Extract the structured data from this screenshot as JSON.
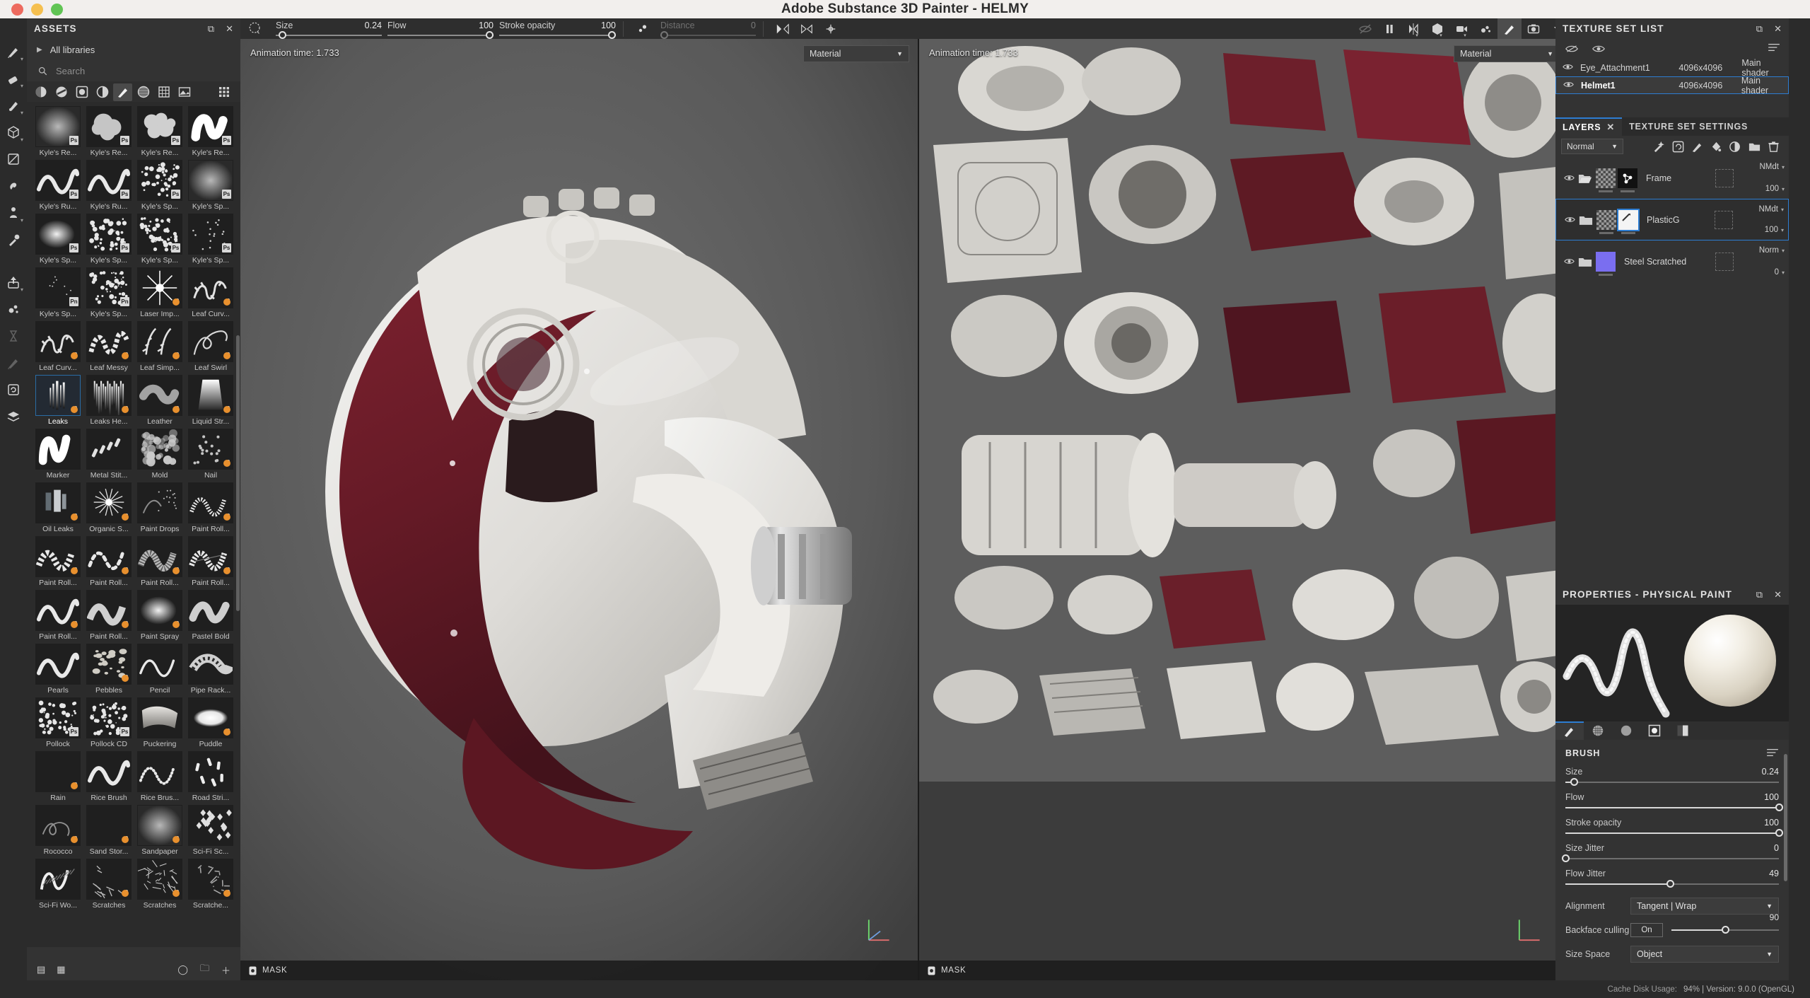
{
  "window": {
    "title": "Adobe Substance 3D Painter - HELMY"
  },
  "toolrail": [
    {
      "name": "paint-brush-tool",
      "icon": "brush",
      "caret": true
    },
    {
      "name": "eraser-tool",
      "icon": "eraser",
      "caret": true
    },
    {
      "name": "projection-tool",
      "icon": "projection",
      "caret": true
    },
    {
      "name": "geometry-decal-tool",
      "icon": "cube",
      "caret": true
    },
    {
      "name": "decal-tool",
      "icon": "decal",
      "caret": false
    },
    {
      "name": "smudge-tool",
      "icon": "smudge",
      "caret": false
    },
    {
      "name": "clone-tool",
      "icon": "clone",
      "caret": true
    },
    {
      "name": "material-picker-tool",
      "icon": "picker",
      "caret": false
    },
    {
      "name": "export-tool",
      "icon": "export",
      "caret": true
    },
    {
      "name": "particles-tool",
      "icon": "particles",
      "caret": false
    },
    {
      "name": "baking-tool",
      "icon": "hourglass",
      "caret": false,
      "dim": true
    },
    {
      "name": "paint-disabled-tool",
      "icon": "brush",
      "caret": false,
      "dim": true
    },
    {
      "name": "generator-tool",
      "icon": "refresh",
      "caret": false
    },
    {
      "name": "layer-stack-tool",
      "icon": "stack",
      "caret": false
    }
  ],
  "assets": {
    "title": "ASSETS",
    "library_label": "All libraries",
    "search_placeholder": "Search",
    "filters": [
      {
        "name": "filter-materials",
        "glyph": "materials"
      },
      {
        "name": "filter-smart-materials",
        "glyph": "smart-materials"
      },
      {
        "name": "filter-masks",
        "glyph": "masks"
      },
      {
        "name": "filter-smart-masks",
        "glyph": "smart-masks"
      },
      {
        "name": "filter-brushes",
        "glyph": "brush",
        "active": true
      },
      {
        "name": "filter-alphas",
        "glyph": "alpha"
      },
      {
        "name": "filter-textures",
        "glyph": "textures"
      },
      {
        "name": "filter-environments",
        "glyph": "environment"
      },
      {
        "name": "filter-grid-view",
        "glyph": "grid"
      }
    ],
    "items": [
      {
        "label": "Kyle's Re...",
        "badge": "Ps",
        "art": "cloud-soft"
      },
      {
        "label": "Kyle's Re...",
        "badge": "Ps",
        "art": "cloud-puff"
      },
      {
        "label": "Kyle's Re...",
        "badge": "Ps",
        "art": "cloud-rough"
      },
      {
        "label": "Kyle's Re...",
        "badge": "Ps",
        "art": "stroke-thick"
      },
      {
        "label": "Kyle's Ru...",
        "badge": "Ps",
        "art": "stroke-wave"
      },
      {
        "label": "Kyle's Ru...",
        "badge": "Ps",
        "art": "stroke-wave"
      },
      {
        "label": "Kyle's Sp...",
        "badge": "Ps",
        "art": "spatter"
      },
      {
        "label": "Kyle's Sp...",
        "badge": "Ps",
        "art": "cloud-soft"
      },
      {
        "label": "Kyle's Sp...",
        "badge": "Ps",
        "art": "spray-dense"
      },
      {
        "label": "Kyle's Sp...",
        "badge": "Ps",
        "art": "spatter"
      },
      {
        "label": "Kyle's Sp...",
        "badge": "Ps",
        "art": "spatter"
      },
      {
        "label": "Kyle's Sp...",
        "badge": "Ps",
        "art": "specks"
      },
      {
        "label": "Kyle's Sp...",
        "badge": "Pn",
        "art": "specks-fine"
      },
      {
        "label": "Kyle's Sp...",
        "badge": "Pn",
        "art": "spatter"
      },
      {
        "label": "Laser Imp...",
        "badge": "bomb",
        "art": "starburst"
      },
      {
        "label": "Leaf Curv...",
        "badge": "bomb",
        "art": "leaf"
      },
      {
        "label": "Leaf Curv...",
        "badge": "bomb",
        "art": "leaf"
      },
      {
        "label": "Leaf Messy",
        "badge": "bomb",
        "art": "leaf-messy"
      },
      {
        "label": "Leaf Simp...",
        "badge": "bomb",
        "art": "leaf-simple"
      },
      {
        "label": "Leaf Swirl",
        "badge": "bomb",
        "art": "leaf-swirl"
      },
      {
        "label": "Leaks",
        "badge": "bomb",
        "art": "leaks",
        "selected": true
      },
      {
        "label": "Leaks He...",
        "badge": "bomb",
        "art": "leaks-heavy"
      },
      {
        "label": "Leather",
        "badge": "bomb",
        "art": "leather"
      },
      {
        "label": "Liquid Str...",
        "badge": "bomb",
        "art": "liquid"
      },
      {
        "label": "Marker",
        "badge": "",
        "art": "marker"
      },
      {
        "label": "Metal Stit...",
        "badge": "",
        "art": "stitch"
      },
      {
        "label": "Mold",
        "badge": "",
        "art": "mold"
      },
      {
        "label": "Nail",
        "badge": "bomb",
        "art": "dots"
      },
      {
        "label": "Oil Leaks",
        "badge": "bomb",
        "art": "oil"
      },
      {
        "label": "Organic S...",
        "badge": "bomb",
        "art": "organic"
      },
      {
        "label": "Paint Drops",
        "badge": "",
        "art": "drops"
      },
      {
        "label": "Paint Roll...",
        "badge": "bomb",
        "art": "roller-a"
      },
      {
        "label": "Paint Roll...",
        "badge": "bomb",
        "art": "roller-b"
      },
      {
        "label": "Paint Roll...",
        "badge": "bomb",
        "art": "roller-c"
      },
      {
        "label": "Paint Roll...",
        "badge": "bomb",
        "art": "roller-d"
      },
      {
        "label": "Paint Roll...",
        "badge": "bomb",
        "art": "roller-e"
      },
      {
        "label": "Paint Roll...",
        "badge": "bomb",
        "art": "stroke-wave"
      },
      {
        "label": "Paint Roll...",
        "badge": "bomb",
        "art": "roller-f"
      },
      {
        "label": "Paint Spray",
        "badge": "bomb",
        "art": "spray-dense"
      },
      {
        "label": "Pastel Bold",
        "badge": "",
        "art": "pastel"
      },
      {
        "label": "Pearls",
        "badge": "",
        "art": "stroke-wave"
      },
      {
        "label": "Pebbles",
        "badge": "bomb",
        "art": "pebbles"
      },
      {
        "label": "Pencil",
        "badge": "",
        "art": "stroke-thin"
      },
      {
        "label": "Pipe Rack...",
        "badge": "",
        "art": "pipe"
      },
      {
        "label": "Pollock",
        "badge": "Ps",
        "art": "spatter"
      },
      {
        "label": "Pollock CD",
        "badge": "Ps",
        "art": "spatter"
      },
      {
        "label": "Puckering",
        "badge": "",
        "art": "pucker"
      },
      {
        "label": "Puddle",
        "badge": "bomb",
        "art": "puddle"
      },
      {
        "label": "Rain",
        "badge": "bomb",
        "art": "rain"
      },
      {
        "label": "Rice Brush",
        "badge": "",
        "art": "stroke-wave"
      },
      {
        "label": "Rice Brus...",
        "badge": "",
        "art": "stroke-dot"
      },
      {
        "label": "Road Stri...",
        "badge": "",
        "art": "dashes"
      },
      {
        "label": "Rococco",
        "badge": "bomb",
        "art": "rococco"
      },
      {
        "label": "Sand Stor...",
        "badge": "bomb",
        "art": "rain"
      },
      {
        "label": "Sandpaper",
        "badge": "bomb",
        "art": "cloud-soft"
      },
      {
        "label": "Sci-Fi Sc...",
        "badge": "",
        "art": "scifi"
      },
      {
        "label": "Sci-Fi Wo...",
        "badge": "",
        "art": "scifiw"
      },
      {
        "label": "Scratches",
        "badge": "bomb",
        "art": "scratch-a"
      },
      {
        "label": "Scratches",
        "badge": "bomb",
        "art": "scratch-b"
      },
      {
        "label": "Scratche...",
        "badge": "bomb",
        "art": "scratch-c"
      }
    ]
  },
  "toolbar": {
    "size_label": "Size",
    "size_value": "0.24",
    "flow_label": "Flow",
    "flow_value": "100",
    "stroke_opacity_label": "Stroke opacity",
    "stroke_opacity_value": "100",
    "distance_label": "Distance",
    "distance_value": "0",
    "icons": [
      {
        "name": "symmetry-toggle-icon"
      },
      {
        "name": "symmetry-plane-icon"
      },
      {
        "name": "symmetry-settings-icon"
      }
    ],
    "right_icons": [
      {
        "name": "hide-painting-icon",
        "dim": true
      },
      {
        "name": "pause-engine-icon"
      },
      {
        "name": "symmetry-mirror-icon",
        "caret": true
      },
      {
        "name": "display-mode-icon",
        "caret": true
      },
      {
        "name": "camera-rotation-icon",
        "caret": true
      },
      {
        "name": "particles-icon"
      },
      {
        "name": "paint-view-icon",
        "active": true
      },
      {
        "name": "screenshot-icon"
      },
      {
        "name": "viewport-settings-icon",
        "caret": true
      }
    ]
  },
  "viewports": {
    "left": {
      "time_label": "Animation time: 1.733",
      "shader_select": "Material",
      "footer": "MASK"
    },
    "right": {
      "time_label": "Animation time: 1.733",
      "shader_select": "Material",
      "footer": "MASK"
    }
  },
  "texture_set_list": {
    "title": "TEXTURE SET LIST",
    "rows": [
      {
        "name": "Eye_Attachment1",
        "resolution": "4096x4096",
        "shader": "Main shader",
        "selected": false
      },
      {
        "name": "Helmet1",
        "resolution": "4096x4096",
        "shader": "Main shader",
        "selected": true
      }
    ]
  },
  "layers_panel": {
    "tabs": [
      {
        "label": "LAYERS",
        "active": true,
        "closable": true
      },
      {
        "label": "TEXTURE SET SETTINGS",
        "active": false
      }
    ],
    "blend_mode": "Normal",
    "tools": [
      {
        "name": "add-effect-button"
      },
      {
        "name": "add-fill-layer-button"
      },
      {
        "name": "add-paint-layer-button"
      },
      {
        "name": "add-mask-button"
      },
      {
        "name": "add-adjustment-button"
      },
      {
        "name": "add-folder-button"
      },
      {
        "name": "delete-layer-button"
      }
    ],
    "layers": [
      {
        "name": "Frame",
        "blend": "NMdt",
        "opacity": "100",
        "selected": false,
        "swatch": "checker",
        "extra": "black-node"
      },
      {
        "name": "PlasticG",
        "blend": "NMdt",
        "opacity": "100",
        "selected": true,
        "swatch": "checker",
        "extra": "white-mask"
      },
      {
        "name": "Steel Scratched",
        "blend": "Norm",
        "opacity": "0",
        "selected": false,
        "swatch": "violet",
        "extra": ""
      }
    ]
  },
  "properties": {
    "title": "PROPERTIES - PHYSICAL PAINT",
    "preview_tabs": [
      {
        "name": "brush-tab",
        "active": true
      },
      {
        "name": "grain-tab",
        "active": false
      },
      {
        "name": "pattern-tab",
        "active": false
      },
      {
        "name": "stencil-tab",
        "active": false
      },
      {
        "name": "gradient-tab",
        "active": false
      }
    ],
    "brush": {
      "section_label": "BRUSH",
      "sliders": [
        {
          "label": "Size",
          "value": "0.24",
          "pct": 4
        },
        {
          "label": "Flow",
          "value": "100",
          "pct": 100
        },
        {
          "label": "Stroke opacity",
          "value": "100",
          "pct": 100
        },
        {
          "label": "Size Jitter",
          "value": "0",
          "pct": 0
        },
        {
          "label": "Flow Jitter",
          "value": "49",
          "pct": 49
        }
      ],
      "alignment_label": "Alignment",
      "alignment_value": "Tangent | Wrap",
      "backface_label": "Backface culling",
      "backface_value": "On",
      "backface_angle": "90",
      "backface_pct": 50,
      "size_space_label": "Size Space",
      "size_space_value": "Object"
    }
  },
  "right_rail": [
    {
      "name": "display-settings-icon"
    },
    {
      "name": "shader-settings-icon"
    },
    {
      "name": "history-icon"
    },
    {
      "name": "texture-set-list-icon"
    },
    {
      "name": "layers-icon"
    }
  ],
  "status_bar": {
    "cache_label": "Cache Disk Usage:",
    "cache_value": "94% | Version: 9.0.0 (OpenGL)"
  }
}
